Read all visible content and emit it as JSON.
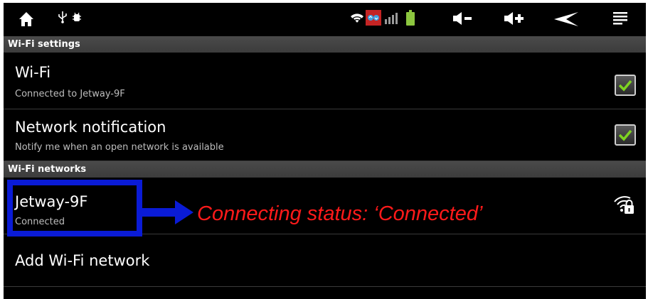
{
  "status_bar": {
    "icons": [
      "home-icon",
      "usb-icon",
      "android-debug-icon",
      "wifi-icon",
      "sync-icon",
      "signal-icon",
      "battery-icon",
      "volume-down-icon",
      "volume-up-icon",
      "back-icon",
      "menu-icon"
    ],
    "battery_color": "#8cc63f"
  },
  "wifi_settings": {
    "header": "Wi-Fi settings",
    "wifi": {
      "title": "Wi-Fi",
      "subtitle": "Connected to Jetway-9F",
      "checked": true
    },
    "notification": {
      "title": "Network notification",
      "subtitle": "Notify me when an open network is available",
      "checked": true
    }
  },
  "wifi_networks": {
    "header": "Wi-Fi networks",
    "networks": [
      {
        "name": "Jetway-9F",
        "status": "Connected",
        "secured": true
      }
    ],
    "add_label": "Add Wi-Fi network"
  },
  "annotation": {
    "text": "Connecting status: ‘Connected’",
    "box_color": "#0a1bd6",
    "text_color": "#ff1a1a"
  }
}
